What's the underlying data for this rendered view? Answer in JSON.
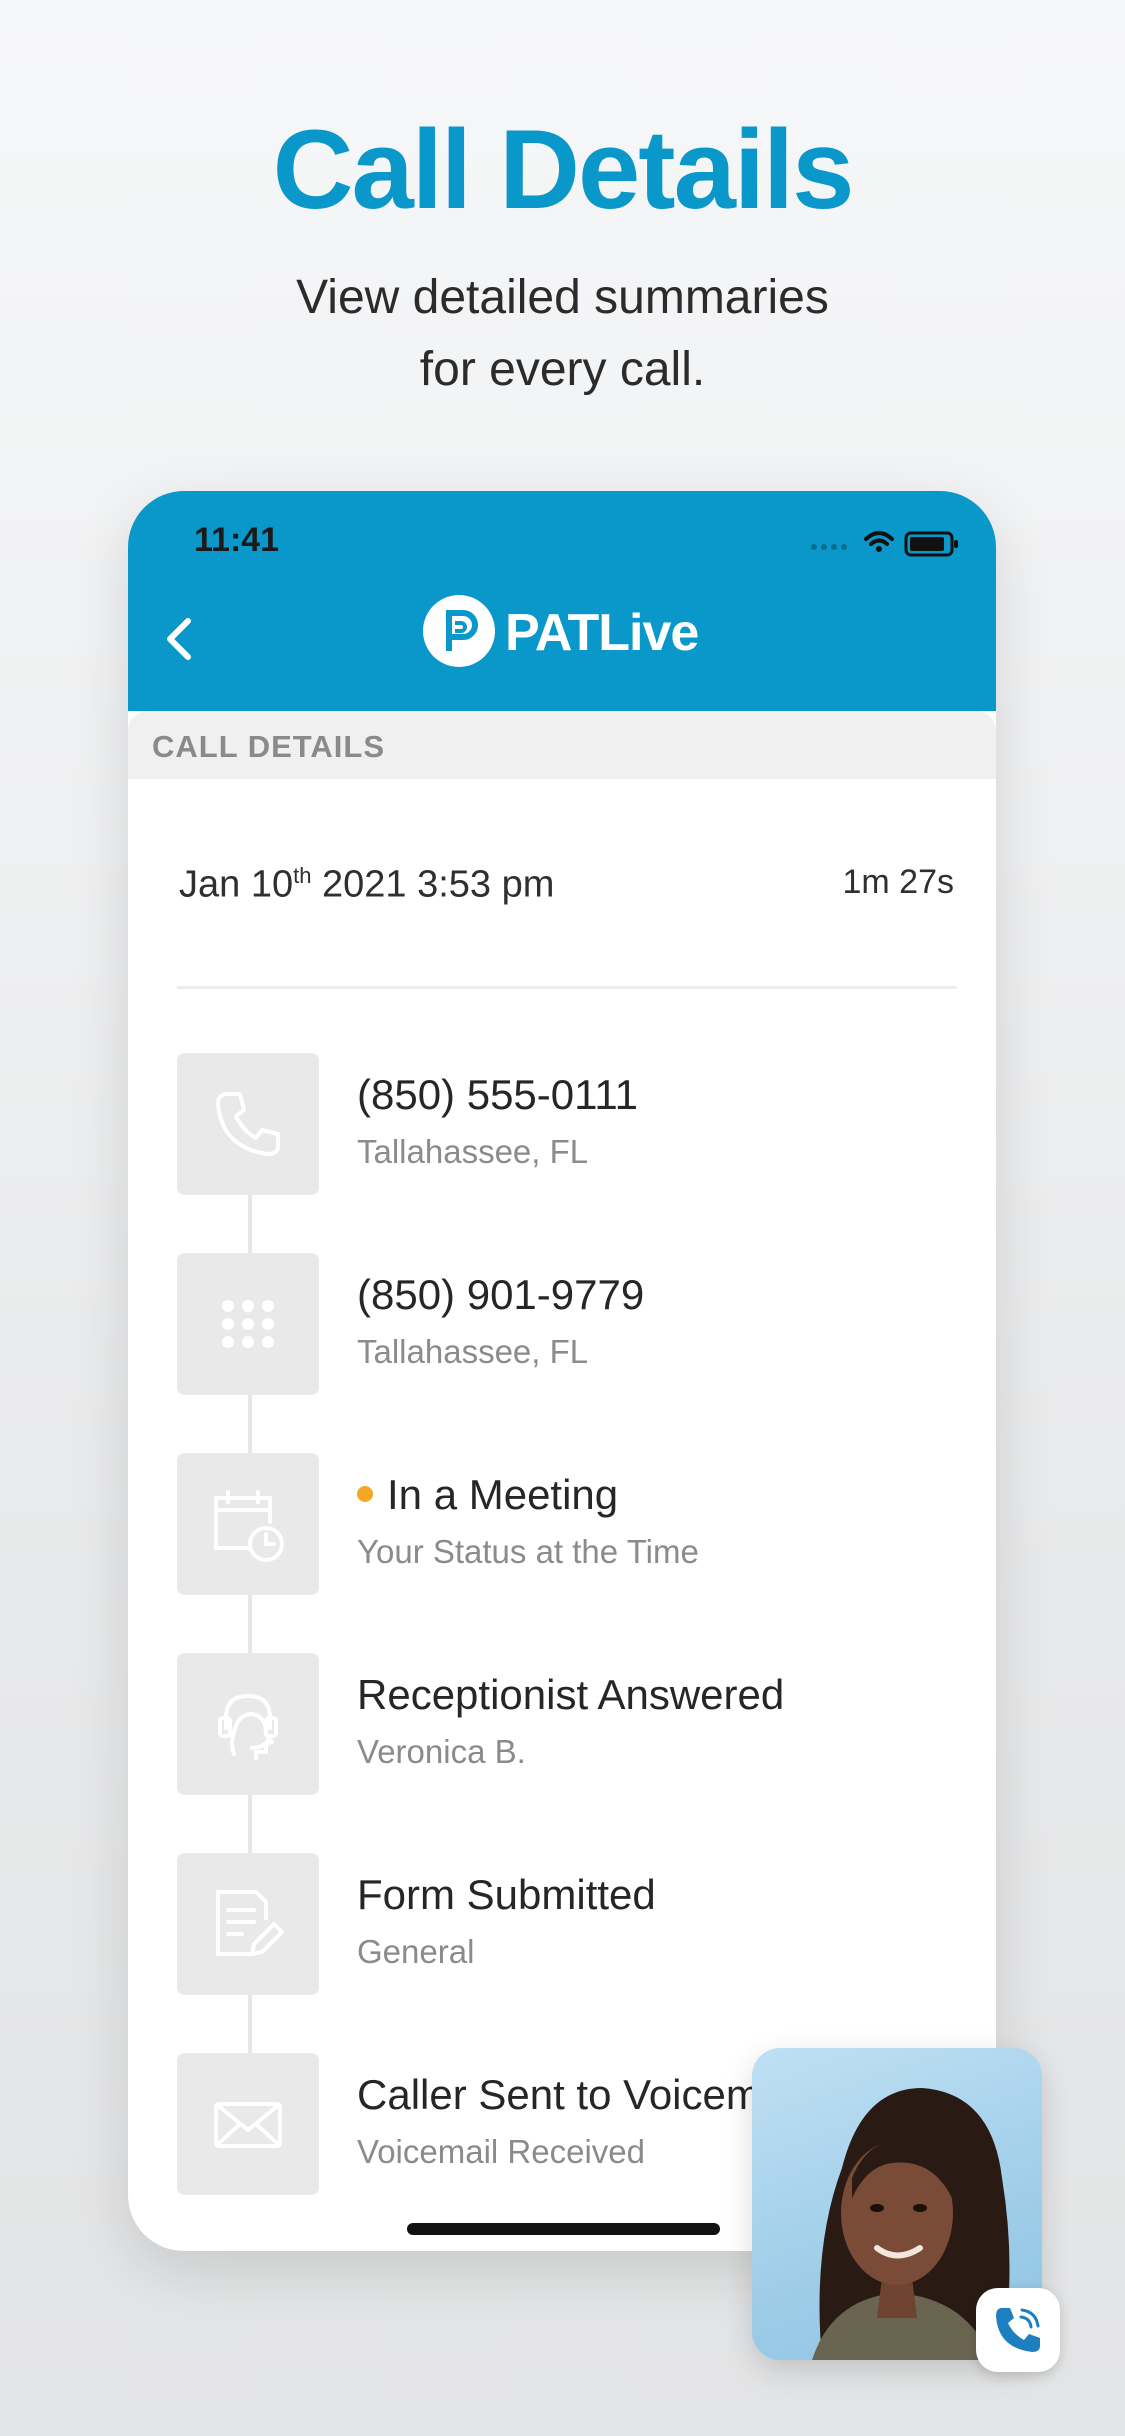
{
  "headline": "Call Details",
  "subline_1": "View detailed summaries",
  "subline_2": "for every call.",
  "status_bar": {
    "time": "11:41"
  },
  "app_bar": {
    "logo_text": "PATLive"
  },
  "section_header": "CALL DETAILS",
  "call": {
    "date_prefix": "Jan 10",
    "date_suffix": "th",
    "date_rest": " 2021 3:53 pm",
    "duration": "1m 27s"
  },
  "items": [
    {
      "icon": "phone-icon",
      "title": "(850) 555-0111",
      "subtitle": "Tallahassee, FL"
    },
    {
      "icon": "dialpad-icon",
      "title": "(850) 901-9779",
      "subtitle": "Tallahassee, FL"
    },
    {
      "icon": "calendar-clock-icon",
      "title": "In a Meeting",
      "subtitle": "Your Status at the Time",
      "status_color": "#f5a623"
    },
    {
      "icon": "headset-icon",
      "title": "Receptionist Answered",
      "subtitle": "Veronica B."
    },
    {
      "icon": "form-icon",
      "title": "Form Submitted",
      "subtitle": "General"
    },
    {
      "icon": "envelope-icon",
      "title": "Caller Sent to Voicemail",
      "subtitle": "Voicemail Received"
    }
  ],
  "colors": {
    "brand": "#0a97c9",
    "status_dot": "#f5a623"
  }
}
